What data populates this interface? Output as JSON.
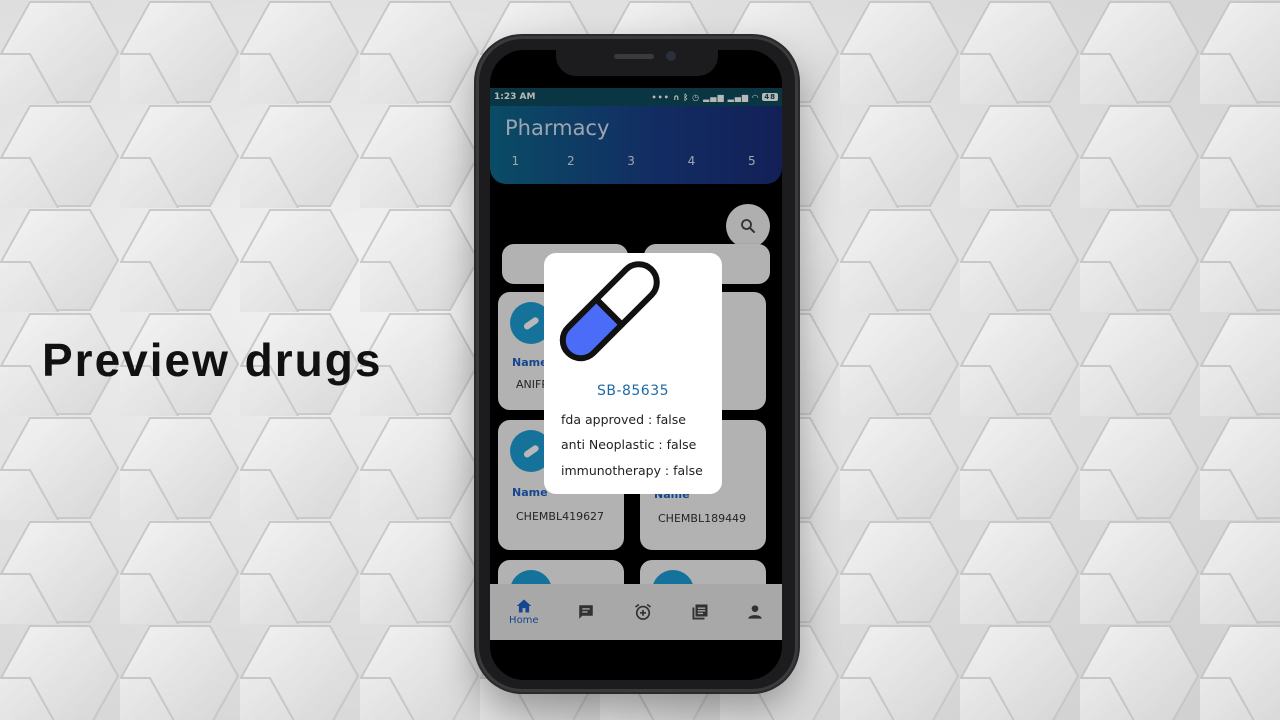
{
  "caption": "Preview drugs",
  "status_bar": {
    "time": "1:23 AM",
    "icons": [
      "more-icon",
      "headphones-icon",
      "bluetooth-icon",
      "alarm-icon",
      "signal-icon",
      "signal-icon",
      "wifi-icon"
    ],
    "battery": "48"
  },
  "app": {
    "title": "Pharmacy",
    "tabs": [
      "1",
      "2",
      "3",
      "4",
      "5"
    ],
    "cards": [
      {
        "label": "Name",
        "value": "ANIFR"
      },
      {
        "label": "Name",
        "value": "CHEMBL419627"
      },
      {
        "label": "Name",
        "value": "CHEMBL189449"
      }
    ],
    "bottom_nav": {
      "home_label": "Home",
      "items": [
        "home-icon",
        "chat-icon",
        "alarm-add-icon",
        "library-books-icon",
        "person-icon"
      ]
    }
  },
  "dialog": {
    "drug_name": "SB-85635",
    "fda_approved": "fda approved : false",
    "anti_neoplastic": "anti Neoplastic : false",
    "immunotherapy": "immunotherapy : false"
  },
  "colors": {
    "appbar_gradient_start": "#0e6a8c",
    "appbar_gradient_end": "#1b2d7a",
    "accent_blue": "#1e62c8",
    "pill_fill": "#4a6cf7"
  }
}
